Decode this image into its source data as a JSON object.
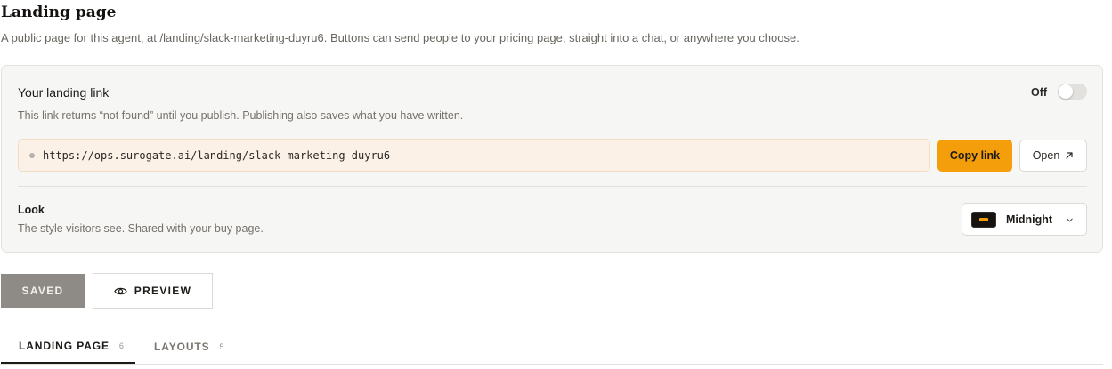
{
  "page": {
    "title": "Landing page",
    "description": "A public page for this agent, at /landing/slack-marketing-duyru6. Buttons can send people to your pricing page, straight into a chat, or anywhere you choose."
  },
  "landing_link": {
    "title": "Your landing link",
    "subtitle": "This link returns “not found” until you publish. Publishing also saves what you have written.",
    "toggle_label": "Off",
    "toggle_on": false,
    "url": "https://ops.surogate.ai/landing/slack-marketing-duyru6",
    "copy_label": "Copy link",
    "open_label": "Open",
    "open_icon": "arrow-up-right-icon"
  },
  "look": {
    "title": "Look",
    "subtitle": "The style visitors see. Shared with your buy page.",
    "theme_name": "Midnight",
    "dropdown_icon": "chevron-down-icon"
  },
  "actions": {
    "saved_label": "SAVED",
    "preview_label": "PREVIEW",
    "preview_icon": "eye-icon"
  },
  "tabs": [
    {
      "label": "LANDING PAGE",
      "count": "6",
      "active": true
    },
    {
      "label": "LAYOUTS",
      "count": "5",
      "active": false
    }
  ],
  "colors": {
    "accent": "#f59e0b",
    "link_box_bg": "#fbf1e7",
    "card_bg": "#f6f6f5",
    "saved_bg": "#8e8b87"
  }
}
